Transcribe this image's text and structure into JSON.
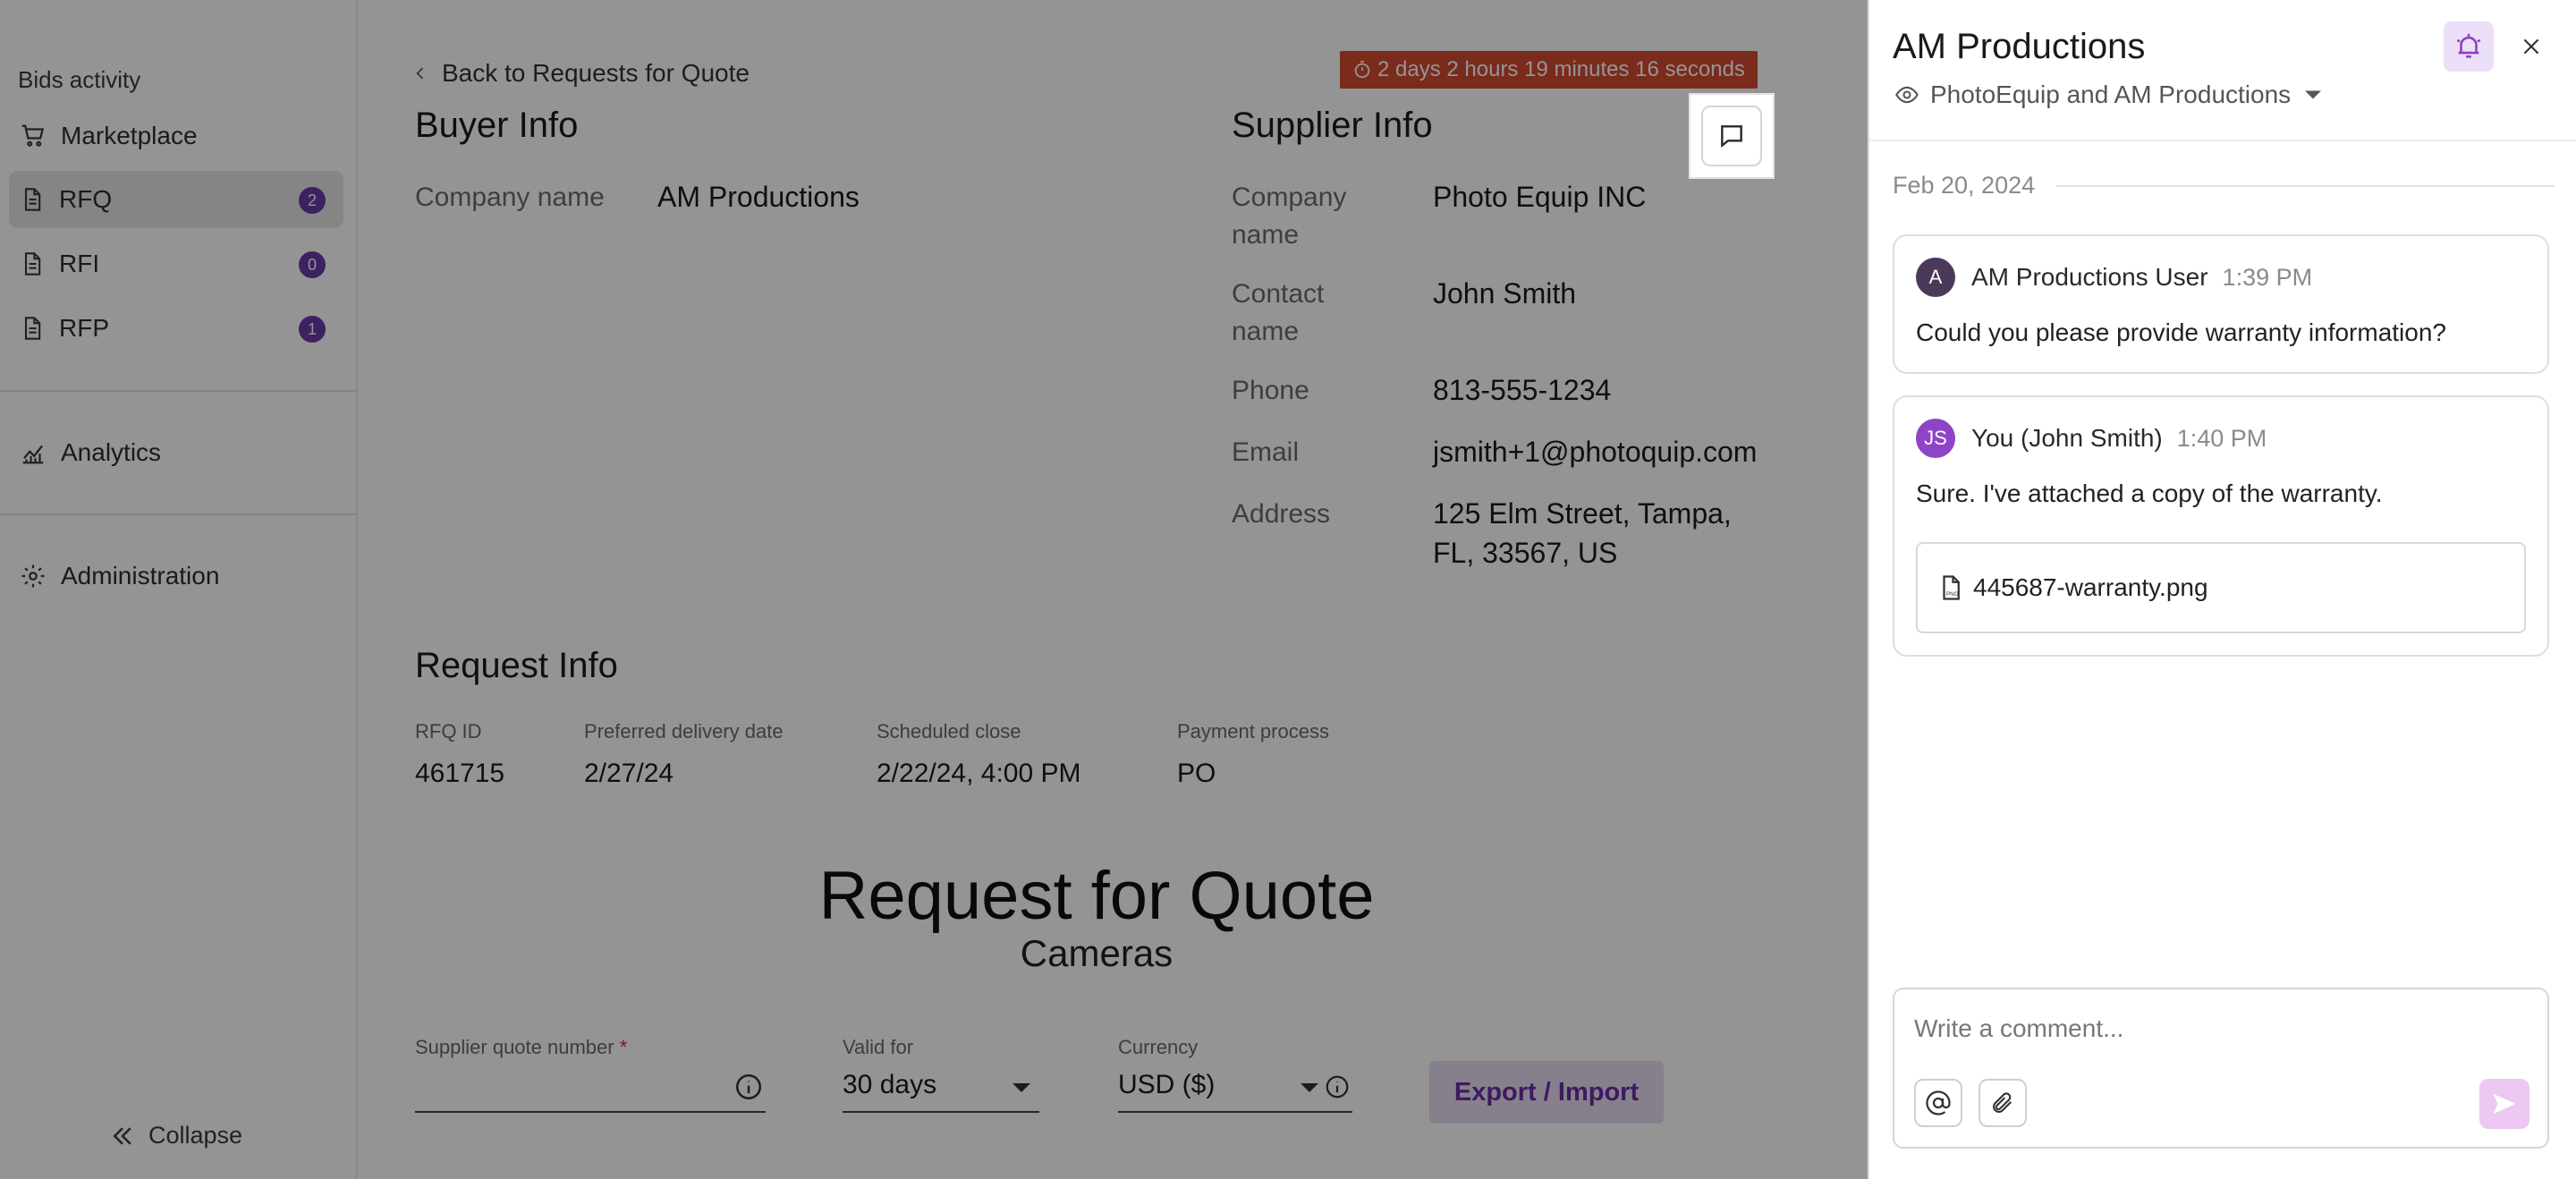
{
  "sidebar": {
    "section_title": "Bids activity",
    "items": [
      {
        "label": "Marketplace",
        "icon": "cart-icon"
      },
      {
        "label": "RFQ",
        "badge": "2",
        "icon": "document-icon"
      },
      {
        "label": "RFI",
        "badge": "0",
        "icon": "document-icon"
      },
      {
        "label": "RFP",
        "badge": "1",
        "icon": "document-icon"
      },
      {
        "label": "Analytics",
        "icon": "chart-icon"
      },
      {
        "label": "Administration",
        "icon": "gear-icon"
      }
    ],
    "collapse_label": "Collapse"
  },
  "main": {
    "back_label": "Back to Requests for Quote",
    "timer": "2 days 2 hours 19 minutes 16 seconds",
    "buyer": {
      "heading": "Buyer Info",
      "company_label": "Company name",
      "company_value": "AM Productions"
    },
    "supplier": {
      "heading": "Supplier Info",
      "company_label_1": "Company",
      "company_label_2": "name",
      "company_value": "Photo Equip INC",
      "contact_label_1": "Contact",
      "contact_label_2": "name",
      "contact_value": "John Smith",
      "phone_label": "Phone",
      "phone_value": "813-555-1234",
      "email_label": "Email",
      "email_value": "jsmith+1@photoquip.com",
      "address_label": "Address",
      "address_line1": "125 Elm Street, Tampa,",
      "address_line2": "FL, 33567, US"
    },
    "request": {
      "heading": "Request Info",
      "rfq_id_label": "RFQ ID",
      "rfq_id_value": "461715",
      "delivery_label": "Preferred delivery date",
      "delivery_value": "2/27/24",
      "close_label": "Scheduled close",
      "close_value": "2/22/24, 4:00 PM",
      "payment_label": "Payment process",
      "payment_value": "PO"
    },
    "doc_title": "Request for Quote",
    "doc_subtitle": "Cameras",
    "form": {
      "quote_number_label": "Supplier quote number",
      "required_mark": "*",
      "valid_for_label": "Valid for",
      "valid_for_value": "30 days",
      "currency_label": "Currency",
      "currency_value": "USD ($)",
      "export_label": "Export / Import"
    }
  },
  "panel": {
    "title": "AM Productions",
    "participants": "PhotoEquip and AM Productions",
    "date": "Feb 20, 2024",
    "messages": [
      {
        "avatar": "A",
        "author": "AM Productions User",
        "time": "1:39 PM",
        "text": "Could you please provide warranty information?",
        "avatar_color": "#4a3a57"
      },
      {
        "avatar": "JS",
        "author": "You (John Smith)",
        "time": "1:40 PM",
        "text": "Sure. I've attached a copy of the warranty.",
        "attachment": "445687-warranty.png",
        "avatar_color": "#8e44c7"
      }
    ],
    "composer_placeholder": "Write a comment..."
  },
  "colors": {
    "accent": "#6b2ea8",
    "timer_bg": "#d34b2f",
    "badge": "#6b3aa7"
  }
}
